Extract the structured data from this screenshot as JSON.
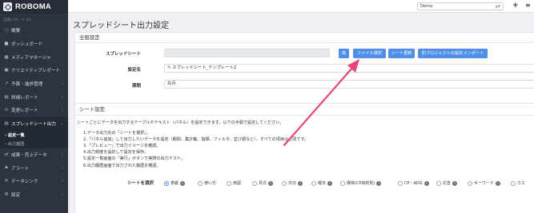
{
  "app": {
    "logo": "ROBOMA",
    "workspace_sub": "全般レポート (ε)"
  },
  "sidebar": {
    "items": [
      {
        "icon": "ⓘ",
        "label": "概要",
        "chev": ""
      },
      {
        "icon": "■",
        "label": "ダッシュボード",
        "chev": ""
      },
      {
        "icon": "▦",
        "label": "メディアマネージャ",
        "chev": ""
      },
      {
        "icon": "▣",
        "label": "クリエイティブレポート",
        "chev": ""
      },
      {
        "icon": "↗",
        "label": "予算・進捗管理",
        "chev": "›"
      },
      {
        "icon": "▤",
        "label": "詳細レポート",
        "chev": "›"
      },
      {
        "icon": "⊙",
        "label": "変更レポート",
        "chev": "›"
      },
      {
        "icon": "▤",
        "label": "スプレッドシート出力",
        "chev": "⌄"
      }
    ],
    "subitems": [
      {
        "label": "› 設定一覧"
      },
      {
        "label": "› 出力履歴"
      }
    ],
    "items_after": [
      {
        "icon": "⇄",
        "label": "成果・売上データ",
        "chev": "›"
      },
      {
        "icon": "⚑",
        "label": "アラート",
        "chev": "›"
      },
      {
        "icon": "⟳",
        "label": "データシンク",
        "chev": "›"
      },
      {
        "icon": "⚙",
        "label": "設定",
        "chev": "›"
      }
    ]
  },
  "topbar": {
    "workspace": "Demo",
    "plus": "+",
    "menu": "≡"
  },
  "page": {
    "title": "スプレッドシート出力設定",
    "general": {
      "title": "全般設定",
      "spreadsheet_label": "スプレッドシート",
      "spreadsheet_value": "",
      "name_label": "設定名",
      "name_value": "スプレッドシート_テンプレート2",
      "period_label": "期間",
      "period_value": "先月",
      "buttons": {
        "open": "⧉",
        "file_select": "ファイル選択",
        "sheet_update": "シート更新",
        "import": "別プロジェクトの設定インポート"
      }
    },
    "sheet": {
      "title": "シート設定",
      "intro": "シートごとにデータを出力するテーブルやテキスト（パネル）を設定できます。以下の手順で設定してください。",
      "steps": [
        "1.データ出力先の「シートを選択」。",
        "2.「パネル追加」して出力したいデータを設定（期間、集計軸、指標、フィルタ、並び順など）。すべての項目は必須です。",
        "3.「プレビュー」で出力イメージを確認。",
        "4.出力頻度を設定して設定を保存。",
        "5.設定一覧画面の「実行」ボタンで実際の出力テスト。",
        "6.出力履歴画面で出力された履歴を確認。"
      ],
      "select_label": "シートを選択",
      "tabs": [
        {
          "label": "表紙",
          "badge": "i",
          "selected": true
        },
        {
          "label": "使い方",
          "badge": "",
          "selected": false
        },
        {
          "label": "用語",
          "badge": "",
          "selected": false
        },
        {
          "label": "月次",
          "badge": "i",
          "selected": false
        },
        {
          "label": "日次",
          "badge": "i",
          "selected": false
        },
        {
          "label": "曜日",
          "badge": "i",
          "selected": false
        },
        {
          "label": "媒体(CP目的別)",
          "badge": "i",
          "selected": false
        },
        {
          "label": "CP・ADG",
          "badge": "i",
          "selected": false
        },
        {
          "label": "広告",
          "badge": "i",
          "selected": false
        },
        {
          "label": "キーワード",
          "badge": "i",
          "selected": false
        },
        {
          "label": "クエ",
          "badge": "",
          "selected": false
        }
      ]
    }
  },
  "colors": {
    "accent": "#4f8fe8",
    "sidebar": "#2c3441",
    "arrow": "#e8437a"
  }
}
